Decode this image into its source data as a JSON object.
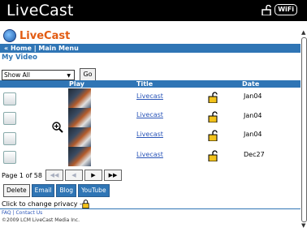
{
  "status_bar": {
    "app_title": "LiveCast",
    "wifi_label": "WiFi"
  },
  "logo": {
    "text": "LiveCast"
  },
  "navbar": {
    "prefix": "« ",
    "home": "Home",
    "separator": " | ",
    "main_menu": "Main Menu"
  },
  "section_title": "My Video",
  "filter": {
    "selected": "Show All",
    "go_label": "Go"
  },
  "table": {
    "headers": {
      "play": "Play",
      "title": "Title",
      "date": "Date"
    },
    "rows": [
      {
        "title": "Livecast",
        "date": "Jan04"
      },
      {
        "title": "Livecast",
        "date": "Jan04"
      },
      {
        "title": "Livecast",
        "date": "Jan04"
      },
      {
        "title": "Livecast",
        "date": "Dec27"
      }
    ]
  },
  "pager": {
    "text": "Page 1 of 58",
    "first": "◀◀",
    "prev": "◀",
    "next": "▶",
    "last": "▶▶"
  },
  "actions": {
    "delete": "Delete",
    "email": "Email",
    "blog": "Blog",
    "youtube": "YouTube"
  },
  "privacy": {
    "text": "Click to change privacy - "
  },
  "footer": {
    "faq": "FAQ",
    "separator": " | ",
    "contact": "Contact Us",
    "copyright": "©2009 LCM LiveCast Media Inc."
  },
  "colors": {
    "accent": "#2f75b5",
    "brand_orange": "#e25b12",
    "link": "#2a55b8"
  }
}
